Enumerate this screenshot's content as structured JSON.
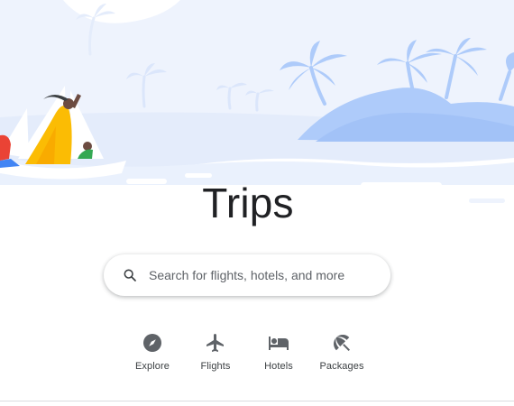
{
  "page": {
    "title": "Trips"
  },
  "search": {
    "placeholder": "Search for flights, hotels, and more",
    "icon": "search-icon"
  },
  "nav": {
    "items": [
      {
        "label": "Explore",
        "icon": "compass-icon"
      },
      {
        "label": "Flights",
        "icon": "airplane-icon"
      },
      {
        "label": "Hotels",
        "icon": "bed-icon"
      },
      {
        "label": "Packages",
        "icon": "beach-umbrella-icon"
      }
    ]
  },
  "colors": {
    "accent": "#aecbfa",
    "text": "#202124",
    "icon": "#5f6368"
  }
}
